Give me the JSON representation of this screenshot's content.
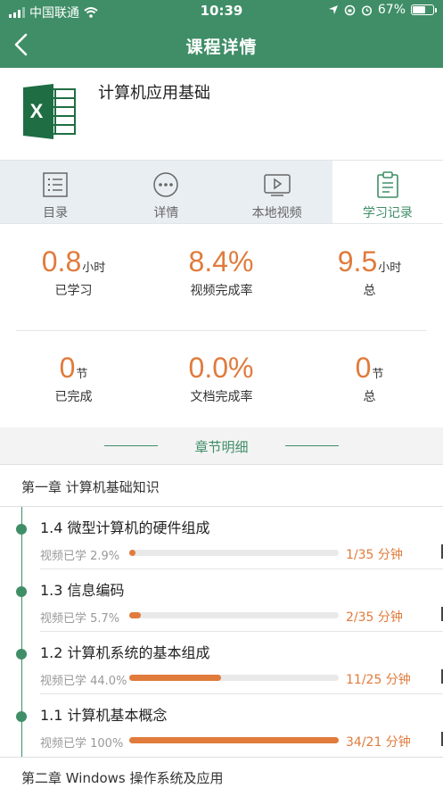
{
  "status_bar": {
    "carrier": "中国联通",
    "time": "10:39",
    "battery": "67%",
    "battery_level": 0.67
  },
  "header": {
    "title": "课程详情",
    "back_icon": "chevron-left-icon"
  },
  "course": {
    "title": "计算机应用基础",
    "icon": "excel-icon"
  },
  "tabs": [
    {
      "label": "目录",
      "icon": "list-icon",
      "active": false
    },
    {
      "label": "详情",
      "icon": "more-icon",
      "active": false
    },
    {
      "label": "本地视频",
      "icon": "video-icon",
      "active": false
    },
    {
      "label": "学习记录",
      "icon": "clipboard-icon",
      "active": true
    }
  ],
  "stats": [
    {
      "value": "0.8",
      "unit": "小时",
      "label": "已学习"
    },
    {
      "value": "8.4%",
      "unit": "",
      "label": "视频完成率"
    },
    {
      "value": "9.5",
      "unit": "小时",
      "label": "总"
    },
    {
      "value": "0",
      "unit": "节",
      "label": "已完成"
    },
    {
      "value": "0.0%",
      "unit": "",
      "label": "文档完成率"
    },
    {
      "value": "0",
      "unit": "节",
      "label": "总"
    }
  ],
  "section_header": "章节明细",
  "chapters": [
    {
      "title": "第一章 计算机基础知识",
      "lessons": [
        {
          "title": "1.4 微型计算机的硬件组成",
          "progress_label": "视频已学 2.9%",
          "progress": 0.029,
          "time": "1/35 分钟"
        },
        {
          "title": "1.3 信息编码",
          "progress_label": "视频已学 5.7%",
          "progress": 0.057,
          "time": "2/35 分钟"
        },
        {
          "title": "1.2 计算机系统的基本组成",
          "progress_label": "视频已学 44.0%",
          "progress": 0.44,
          "time": "11/25 分钟"
        },
        {
          "title": "1.1 计算机基本概念",
          "progress_label": "视频已学 100%",
          "progress": 1.0,
          "time": "34/21 分钟"
        }
      ]
    },
    {
      "title": "第二章 Windows 操作系统及应用",
      "lessons": []
    }
  ],
  "colors": {
    "primary": "#3f8e67",
    "accent": "#e07b3c",
    "excel": "#1f6e43"
  }
}
